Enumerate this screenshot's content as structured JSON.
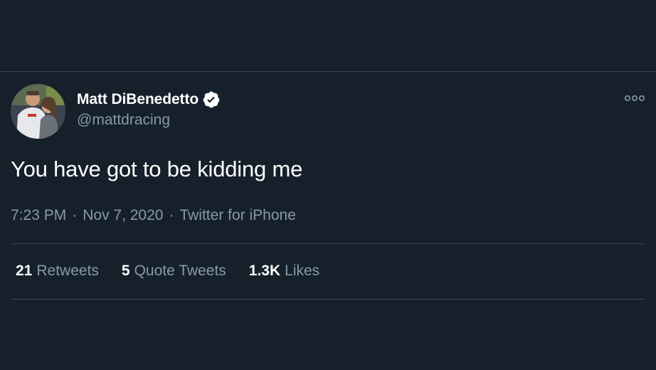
{
  "tweet": {
    "author": {
      "display_name": "Matt DiBenedetto",
      "handle": "@mattdracing",
      "verified": true
    },
    "text": "You have got to be kidding me",
    "time": "7:23 PM",
    "date": "Nov 7, 2020",
    "source": "Twitter for iPhone",
    "separator": "·",
    "stats": {
      "retweets": {
        "count": "21",
        "label": "Retweets"
      },
      "quote_tweets": {
        "count": "5",
        "label": "Quote Tweets"
      },
      "likes": {
        "count": "1.3K",
        "label": "Likes"
      }
    }
  },
  "icons": {
    "verified": "verified-badge-icon",
    "more": "more-options-icon"
  },
  "colors": {
    "background": "#15202b",
    "text_primary": "#ffffff",
    "text_secondary": "#8899a6",
    "divider": "#38444d"
  }
}
